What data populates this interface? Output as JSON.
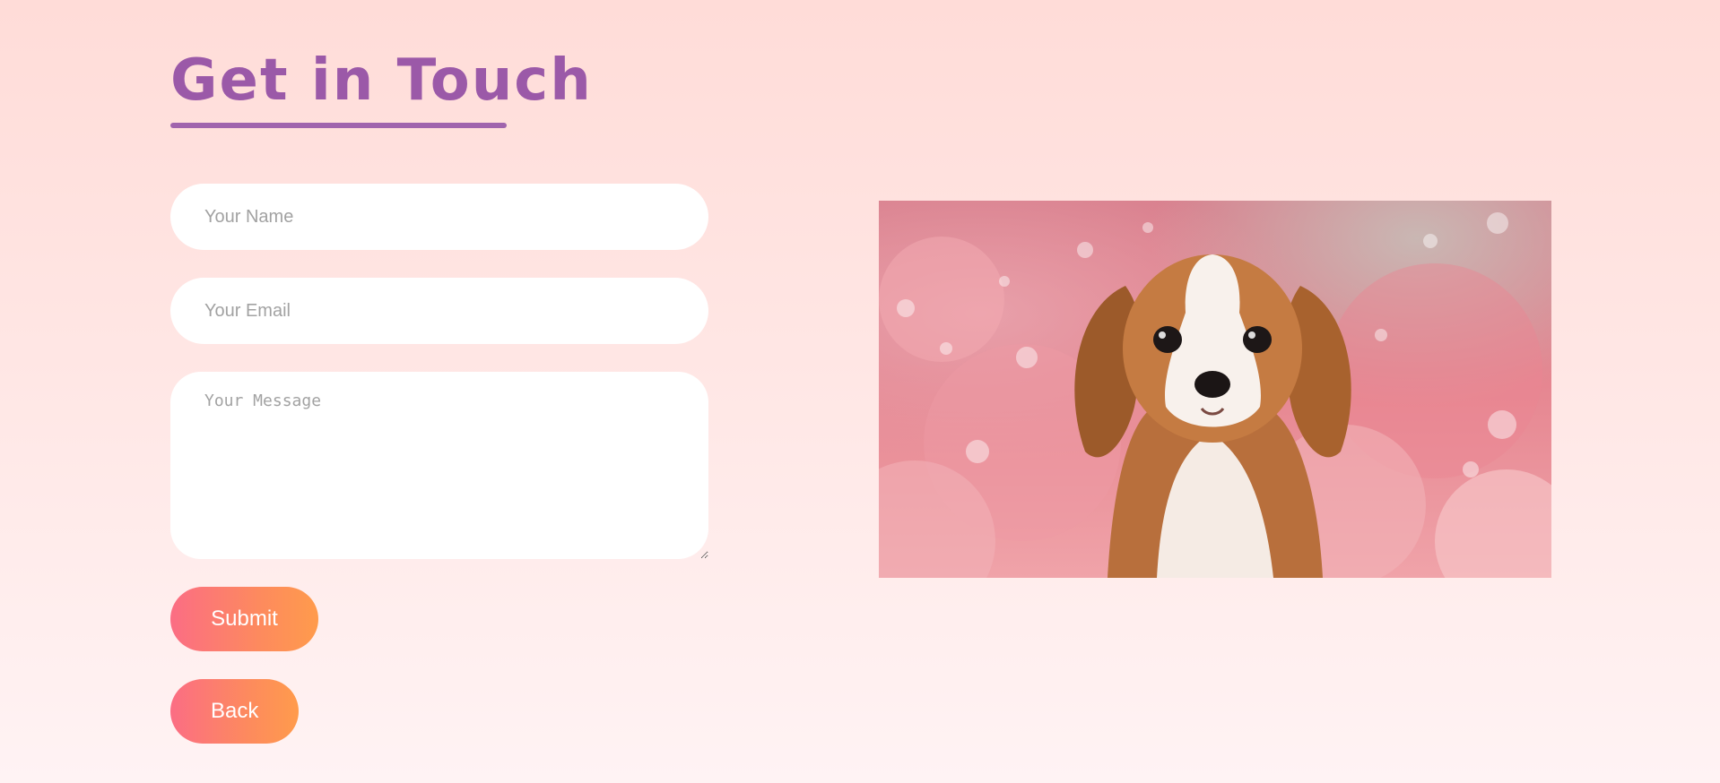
{
  "header": {
    "title": "Get in Touch"
  },
  "form": {
    "name_placeholder": "Your Name",
    "email_placeholder": "Your Email",
    "message_placeholder": "Your Message",
    "submit_label": "Submit",
    "back_label": "Back"
  },
  "image": {
    "alt": "puppy"
  },
  "colors": {
    "title": "#9b59a8",
    "button_gradient_start": "#fb6d84",
    "button_gradient_end": "#ff9b4c",
    "background_top": "#ffdcd8",
    "background_bottom": "#fff3f4"
  }
}
